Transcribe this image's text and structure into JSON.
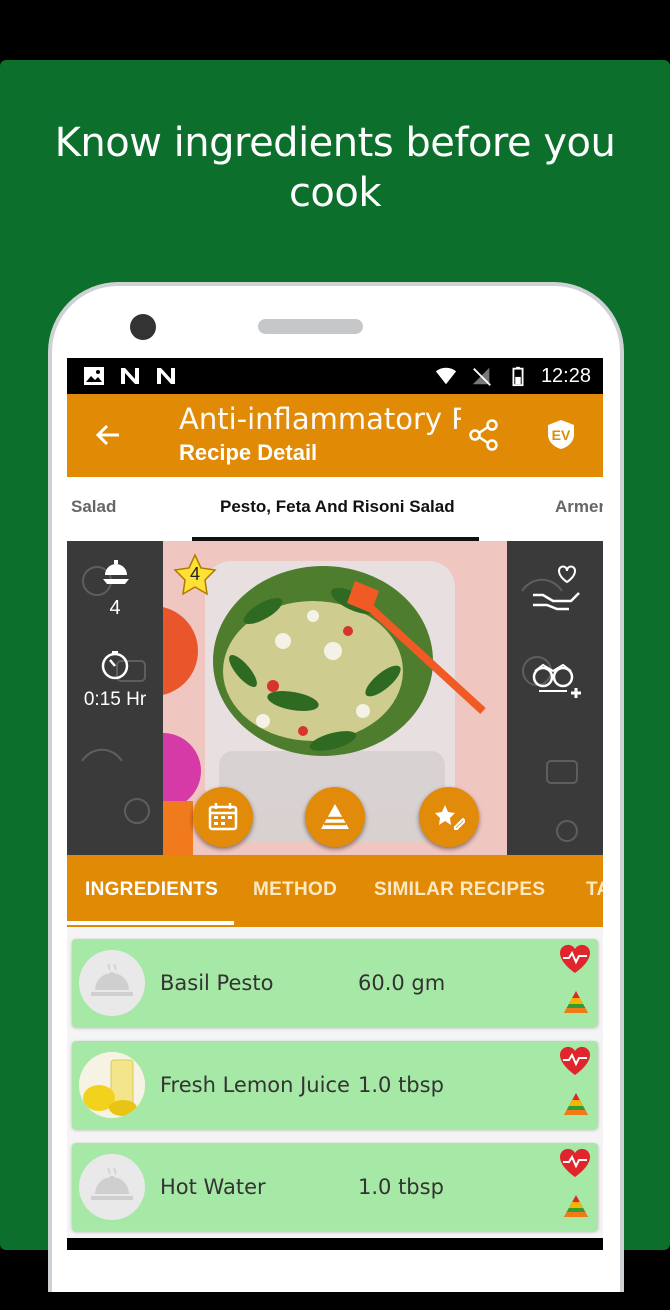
{
  "headline": "Know ingredients before you cook",
  "status_bar": {
    "time": "12:28"
  },
  "app_bar": {
    "title": "Anti-inflammatory R",
    "subtitle": "Recipe Detail",
    "icons": [
      "back-arrow-icon",
      "share-icon",
      "veg-badge-icon"
    ]
  },
  "recipe_tabs": [
    {
      "label": "Salad"
    },
    {
      "label": "Pesto, Feta And Risoni Salad",
      "active": true
    },
    {
      "label": "Armen"
    }
  ],
  "hero": {
    "servings": "4",
    "time": "0:15 Hr",
    "rating": "4",
    "actions": [
      "calendar-icon",
      "food-pyramid-icon",
      "rate-review-icon"
    ],
    "side_actions": [
      "donate-heart-hand-icon",
      "add-owl-icon"
    ]
  },
  "tabs": [
    {
      "label": "INGREDIENTS",
      "active": true
    },
    {
      "label": "METHOD"
    },
    {
      "label": "SIMILAR RECIPES"
    },
    {
      "label": "TA"
    }
  ],
  "ingredients": [
    {
      "name": "Basil Pesto",
      "quantity": "60.0 gm",
      "thumb": "cloche-icon"
    },
    {
      "name": "Fresh Lemon Juice",
      "quantity": "1.0 tbsp",
      "thumb": "lemon-juice-image"
    },
    {
      "name": "Hot Water",
      "quantity": "1.0 tbsp",
      "thumb": "cloche-icon"
    }
  ],
  "colors": {
    "banner_green": "#0c6f2c",
    "accent_orange": "#e08a06",
    "card_green": "#a6e8a6"
  }
}
